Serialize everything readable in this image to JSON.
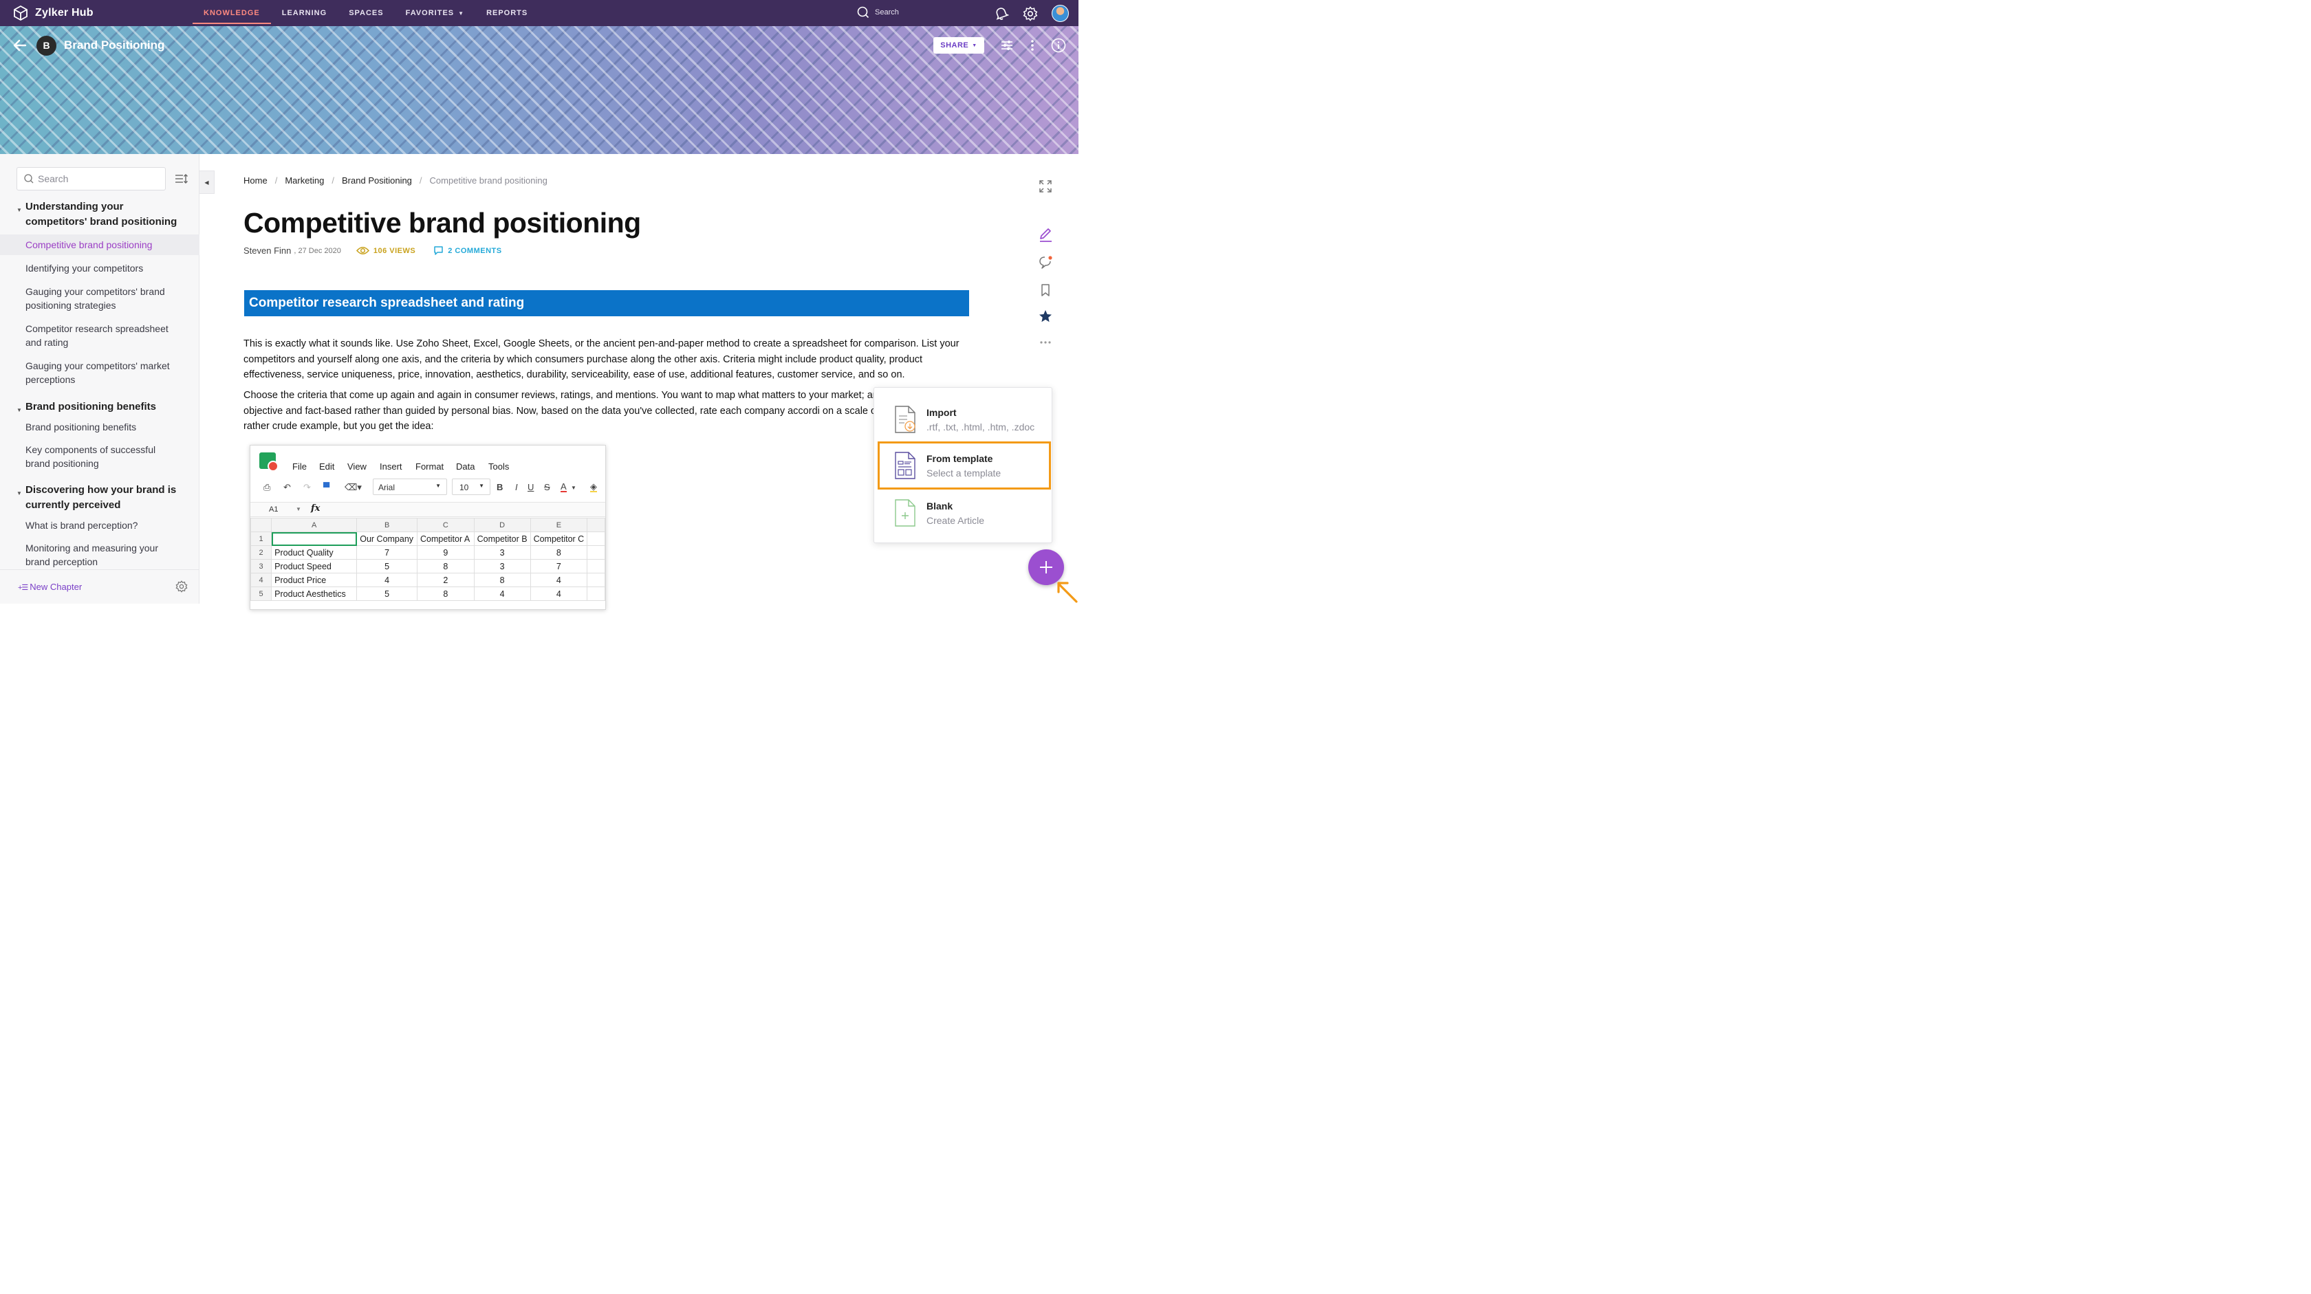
{
  "app": {
    "name": "Zylker Hub"
  },
  "nav": {
    "tabs": [
      {
        "label": "KNOWLEDGE",
        "active": true
      },
      {
        "label": "LEARNING"
      },
      {
        "label": "SPACES"
      },
      {
        "label": "FAVORITES",
        "has_caret": true
      },
      {
        "label": "REPORTS"
      }
    ],
    "search_label": "Search"
  },
  "space": {
    "initial": "B",
    "title": "Brand Positioning",
    "share_label": "SHARE"
  },
  "sidebar": {
    "search_placeholder": "Search",
    "chapters": [
      {
        "title": "Understanding your competitors' brand positioning",
        "articles": [
          "Competitive brand positioning",
          "Identifying your competitors",
          "Gauging your competitors' brand positioning strategies",
          "Competitor research spreadsheet and rating",
          "Gauging your competitors' market perceptions"
        ],
        "active_article": 0
      },
      {
        "title": "Brand positioning benefits",
        "articles": [
          "Brand positioning benefits",
          "Key components of successful brand positioning"
        ]
      },
      {
        "title": "Discovering how your brand is currently perceived",
        "articles": [
          "What is brand perception?",
          "Monitoring and measuring your brand perception"
        ]
      }
    ],
    "new_chapter_label": "New Chapter"
  },
  "breadcrumb": [
    "Home",
    "Marketing",
    "Brand Positioning",
    "Competitive brand positioning"
  ],
  "article": {
    "title": "Competitive brand positioning",
    "author": "Steven Finn",
    "date": ", 27 Dec 2020",
    "views": "106 VIEWS",
    "comments": "2 COMMENTS",
    "section_heading": "Competitor research spreadsheet and rating",
    "paragraph1": "This is exactly what it sounds like. Use Zoho Sheet, Excel, Google Sheets, or the ancient pen-and-paper method to create a spreadsheet for comparison. List your competitors and yourself along one axis, and the criteria by which consumers purchase along the other axis. Criteria might include product quality, product effectiveness, service uniqueness, price, innovation, aesthetics, durability, serviceability, ease of use, additional features, customer service, and so on.",
    "paragraph2": "Choose the criteria that come up again and again in consumer reviews, ratings, and mentions. You want to map what matters to your market; an ratings to be objective and fact-based rather than guided by personal bias. Now, based on the data you've collected, rate each company accordi on a scale of 1-10. The below is a rather crude example, but you get the idea:"
  },
  "spreadsheet": {
    "menu": [
      "File",
      "Edit",
      "View",
      "Insert",
      "Format",
      "Data",
      "Tools"
    ],
    "font": "Arial",
    "font_size": "10",
    "cell_ref": "A1",
    "fx": "fx",
    "col_headers": [
      "A",
      "B",
      "C",
      "D",
      "E"
    ],
    "rows": [
      {
        "n": "1",
        "cells": [
          "",
          "Our Company",
          "Competitor A",
          "Competitor B",
          "Competitor C"
        ]
      },
      {
        "n": "2",
        "cells": [
          "Product Quality",
          "7",
          "9",
          "3",
          "8"
        ]
      },
      {
        "n": "3",
        "cells": [
          "Product Speed",
          "5",
          "8",
          "3",
          "7"
        ]
      },
      {
        "n": "4",
        "cells": [
          "Product Price",
          "4",
          "2",
          "8",
          "4"
        ]
      },
      {
        "n": "5",
        "cells": [
          "Product Aesthetics",
          "5",
          "8",
          "4",
          "4"
        ]
      }
    ]
  },
  "create_menu": {
    "options": [
      {
        "label": "Import",
        "sub": ".rtf, .txt, .html, .htm, .zdoc"
      },
      {
        "label": "From template",
        "sub": "Select a template",
        "highlighted": true
      },
      {
        "label": "Blank",
        "sub": "Create Article"
      }
    ]
  },
  "colors": {
    "nav_bg": "#3f2d5c",
    "accent": "#9b4fd0",
    "active_tab": "#ff8a80",
    "section_blue": "#0b73c8",
    "highlight": "#f39a16"
  }
}
